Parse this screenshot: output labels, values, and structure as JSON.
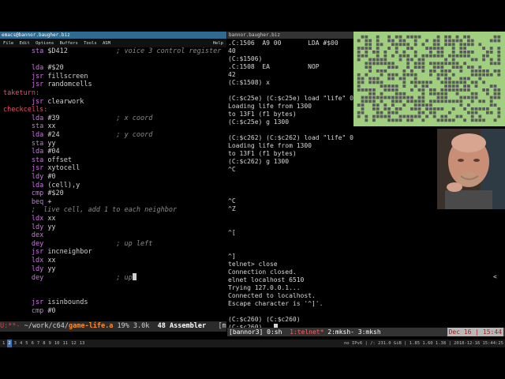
{
  "emacs": {
    "title": "emacs@bannor.baugher.biz",
    "menu": [
      "File",
      "Edit",
      "Options",
      "Buffers",
      "Tools",
      "ASM"
    ],
    "help": "Help",
    "lines": [
      {
        "mnemonic": "sta",
        "operand": "$D412",
        "comment": "; voice 3 control register"
      },
      {
        "blank": true
      },
      {
        "mnemonic": "lda",
        "operand": "#$20"
      },
      {
        "mnemonic": "jsr",
        "operand": "fillscreen"
      },
      {
        "mnemonic": "jsr",
        "operand": "randomcells"
      },
      {
        "label": "taketurn:"
      },
      {
        "mnemonic": "jsr",
        "operand": "clearwork"
      },
      {
        "label": "checkcells:"
      },
      {
        "mnemonic": "lda",
        "operand": "#39",
        "comment": "; x coord"
      },
      {
        "mnemonic": "sta",
        "operand": "xx"
      },
      {
        "mnemonic": "lda",
        "operand": "#24",
        "comment": "; y coord"
      },
      {
        "mnemonic": "sta",
        "operand": "yy"
      },
      {
        "mnemonic": "lda",
        "operand": "#04"
      },
      {
        "mnemonic": "sta",
        "operand": "offset"
      },
      {
        "mnemonic": "jsr",
        "operand": "xytocell"
      },
      {
        "mnemonic": "ldy",
        "operand": "#0"
      },
      {
        "mnemonic": "lda",
        "operand": "(cell),y"
      },
      {
        "mnemonic": "cmp",
        "operand": "#$20"
      },
      {
        "mnemonic": "beq",
        "operand": "+"
      },
      {
        "comment_only": ";  live cell, add 1 to each neighbor"
      },
      {
        "mnemonic": "ldx",
        "operand": "xx"
      },
      {
        "mnemonic": "ldy",
        "operand": "yy"
      },
      {
        "mnemonic": "dex",
        "operand": ""
      },
      {
        "mnemonic": "dey",
        "operand": "",
        "comment": "; up left"
      },
      {
        "mnemonic": "jsr",
        "operand": "incneighbor"
      },
      {
        "mnemonic": "ldx",
        "operand": "xx"
      },
      {
        "mnemonic": "ldy",
        "operand": "yy"
      },
      {
        "mnemonic": "dey",
        "operand": "",
        "comment": "; up"
      },
      {
        "blank": true
      },
      {
        "blank": true
      },
      {
        "mnemonic": "jsr",
        "operand": "isinbounds"
      },
      {
        "mnemonic": "cmp",
        "operand": "#0"
      }
    ],
    "modeline": {
      "prefix": "U:**-",
      "path": " ~/work/c64/",
      "filename": "game-life.a",
      "position": "19% 3.0k",
      "line": "48",
      "mode": "Assembler",
      "tail": "[m"
    }
  },
  "terminal": {
    "title": "bannor.baugher.biz",
    "lines": [
      ".C:1506  A9 00       LDA #$00",
      "40",
      "(C:$1506)",
      ".C:1508  EA          NOP",
      "42",
      "(C:$1508) x",
      "",
      "(C:$c25e) (C:$c25e) load \"life\" 0",
      "Loading life from 1300",
      "to 13F1 (f1 bytes)",
      "(C:$c25e) g 1300",
      "",
      "(C:$c262) (C:$c262) load \"life\" 0",
      "Loading life from 1300",
      "to 13F1 (f1 bytes)",
      "(C:$c262) g 1300",
      "^C",
      "",
      "",
      "",
      "^C",
      "^Z",
      "",
      "",
      "^[",
      "",
      "",
      "^]",
      "telnet> close",
      "Connection closed.",
      "elnet localhost 6510",
      "Trying 127.0.0.1...",
      "Connected to localhost.",
      "Escape character is '^]'.",
      "",
      "(C:$c260) (C:$c260)",
      "(C:$c260)"
    ],
    "right_marker": "<"
  },
  "tmux": {
    "session": "[bannor3] 0:sh",
    "win1": "1:telnet*",
    "rest": " 2:mksh- 3:mksh",
    "date": "Dec 16 | 15:44"
  },
  "bottombar": {
    "workspaces": [
      "1",
      "2",
      "3",
      "4",
      "5",
      "6",
      "7",
      "8",
      "9",
      "10",
      "11",
      "12",
      "13"
    ],
    "current": "2",
    "sysinfo": "no IPv6 | /: 231.0 GiB | 1.85 1.60 1.38 | 2018-12-16 15:44:25"
  },
  "colors": {
    "label": "#e7506c",
    "instruction": "#c678dd",
    "comment": "#8a8a8a",
    "life_bg": "#9fcf7f",
    "life_cell": "#5a5a5a"
  }
}
